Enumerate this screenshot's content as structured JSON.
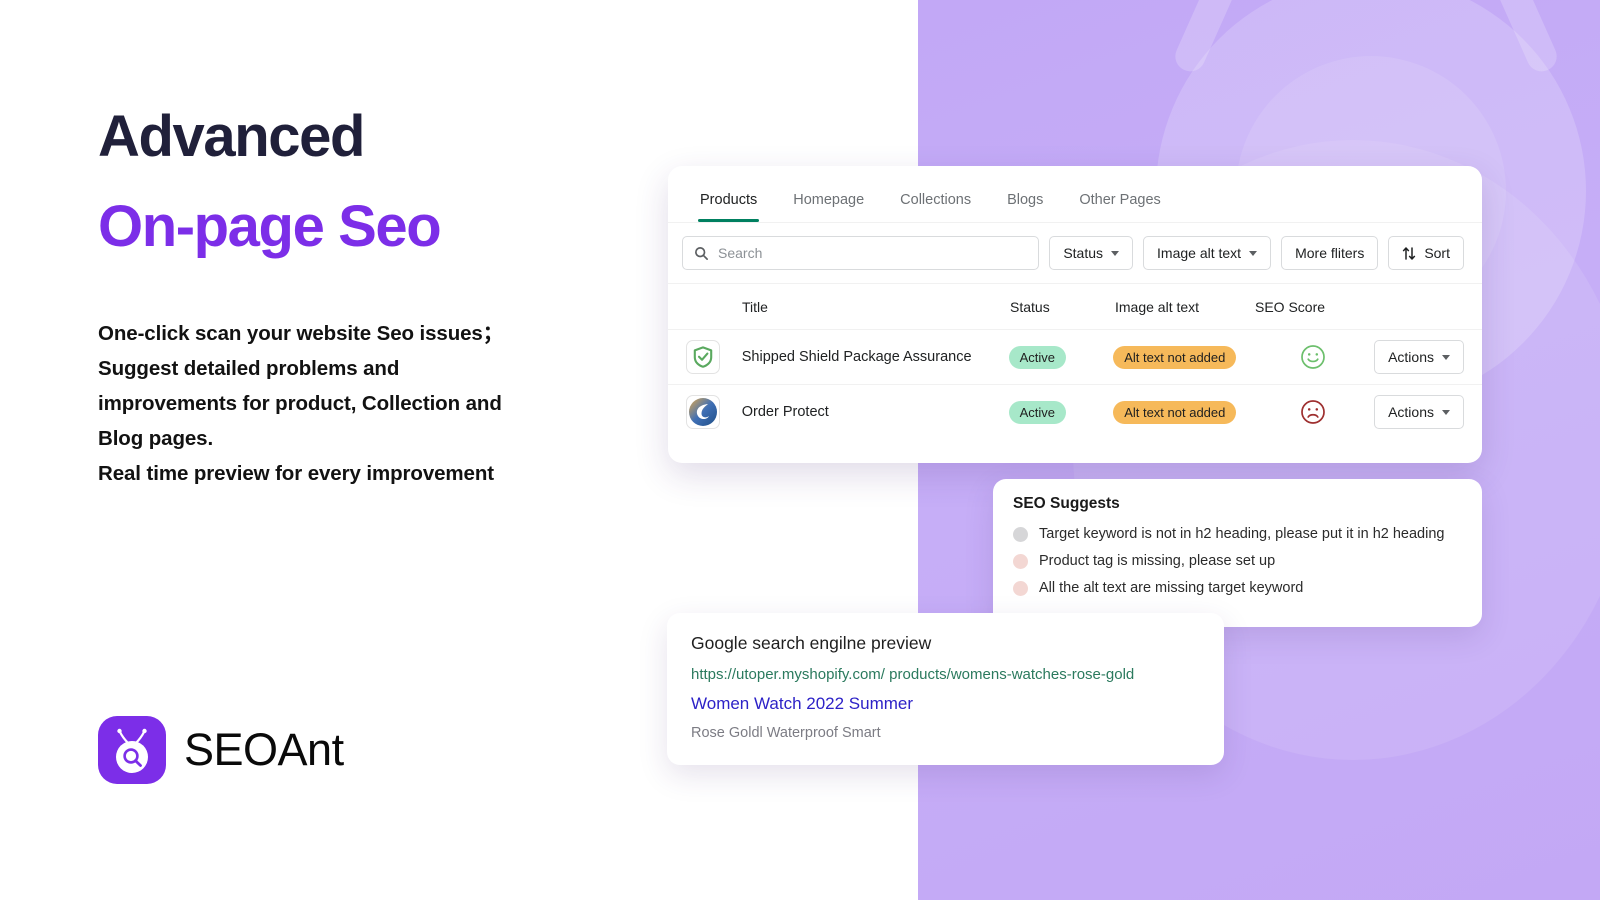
{
  "hero": {
    "heading_line1": "Advanced",
    "heading_line2": "On-page Seo",
    "heading_color_dark": "#20203a",
    "heading_color_accent": "#7c2ee8",
    "body_lines": [
      "One-click scan your website Seo issues；",
      "Suggest detailed problems and",
      "improvements for product, Collection and",
      "Blog pages.",
      "Real time preview for every improvement"
    ],
    "logo_text": "SEOAnt",
    "logo_icon": "seoant-ant-magnifier-icon",
    "brand_color": "#7c2ee8"
  },
  "app": {
    "tabs": [
      {
        "label": "Products",
        "active": true
      },
      {
        "label": "Homepage",
        "active": false
      },
      {
        "label": "Collections",
        "active": false
      },
      {
        "label": "Blogs",
        "active": false
      },
      {
        "label": "Other Pages",
        "active": false
      }
    ],
    "active_tab_color": "#008060",
    "filters": {
      "search_placeholder": "Search",
      "search_value": "",
      "search_icon": "search-icon",
      "status_label": "Status",
      "image_alt_text_label": "Image alt text",
      "more_filters_label": "More fliters",
      "sort_label": "Sort",
      "sort_icon": "sort-arrows-icon"
    },
    "table": {
      "columns": [
        "",
        "Title",
        "Status",
        "Image alt text",
        "SEO Score",
        ""
      ],
      "rows": [
        {
          "thumb_icon": "green-shield-check-icon",
          "title": "Shipped Shield Package Assurance",
          "status": "Active",
          "alt_text": "Alt text not added",
          "score_icon": "smiley-happy-icon",
          "score_color": "#6cbf6c",
          "action_label": "Actions"
        },
        {
          "thumb_icon": "blue-gold-swirl-icon",
          "title": "Order Protect",
          "status": "Active",
          "alt_text": "Alt text not added",
          "score_icon": "smiley-sad-icon",
          "score_color": "#9e2f2f",
          "action_label": "Actions"
        }
      ],
      "status_badge_color": "#a7e8c9",
      "alt_badge_color": "#f6b95a"
    }
  },
  "seo_suggests": {
    "title": "SEO Suggests",
    "items": [
      {
        "text": "Target keyword is not in h2 heading, please put it in h2 heading",
        "dot_color": "#d6d6d8"
      },
      {
        "text": "Product tag is missing, please set up",
        "dot_color": "#f3d7d3"
      },
      {
        "text": "All the alt text are missing target keyword",
        "dot_color": "#f3d7d3"
      }
    ]
  },
  "google_preview": {
    "heading": "Google search engilne preview",
    "url": "https://utoper.myshopify.com/ products/womens-watches-rose-gold",
    "title": "Women Watch 2022 Summer",
    "description": "Rose Goldl Waterproof Smart",
    "url_color": "#2b7a5e",
    "title_color": "#2d22c7"
  },
  "background": {
    "panel_color": "#c3a8f5",
    "watermark_icon": "seoant-ant-watermark-icon"
  }
}
